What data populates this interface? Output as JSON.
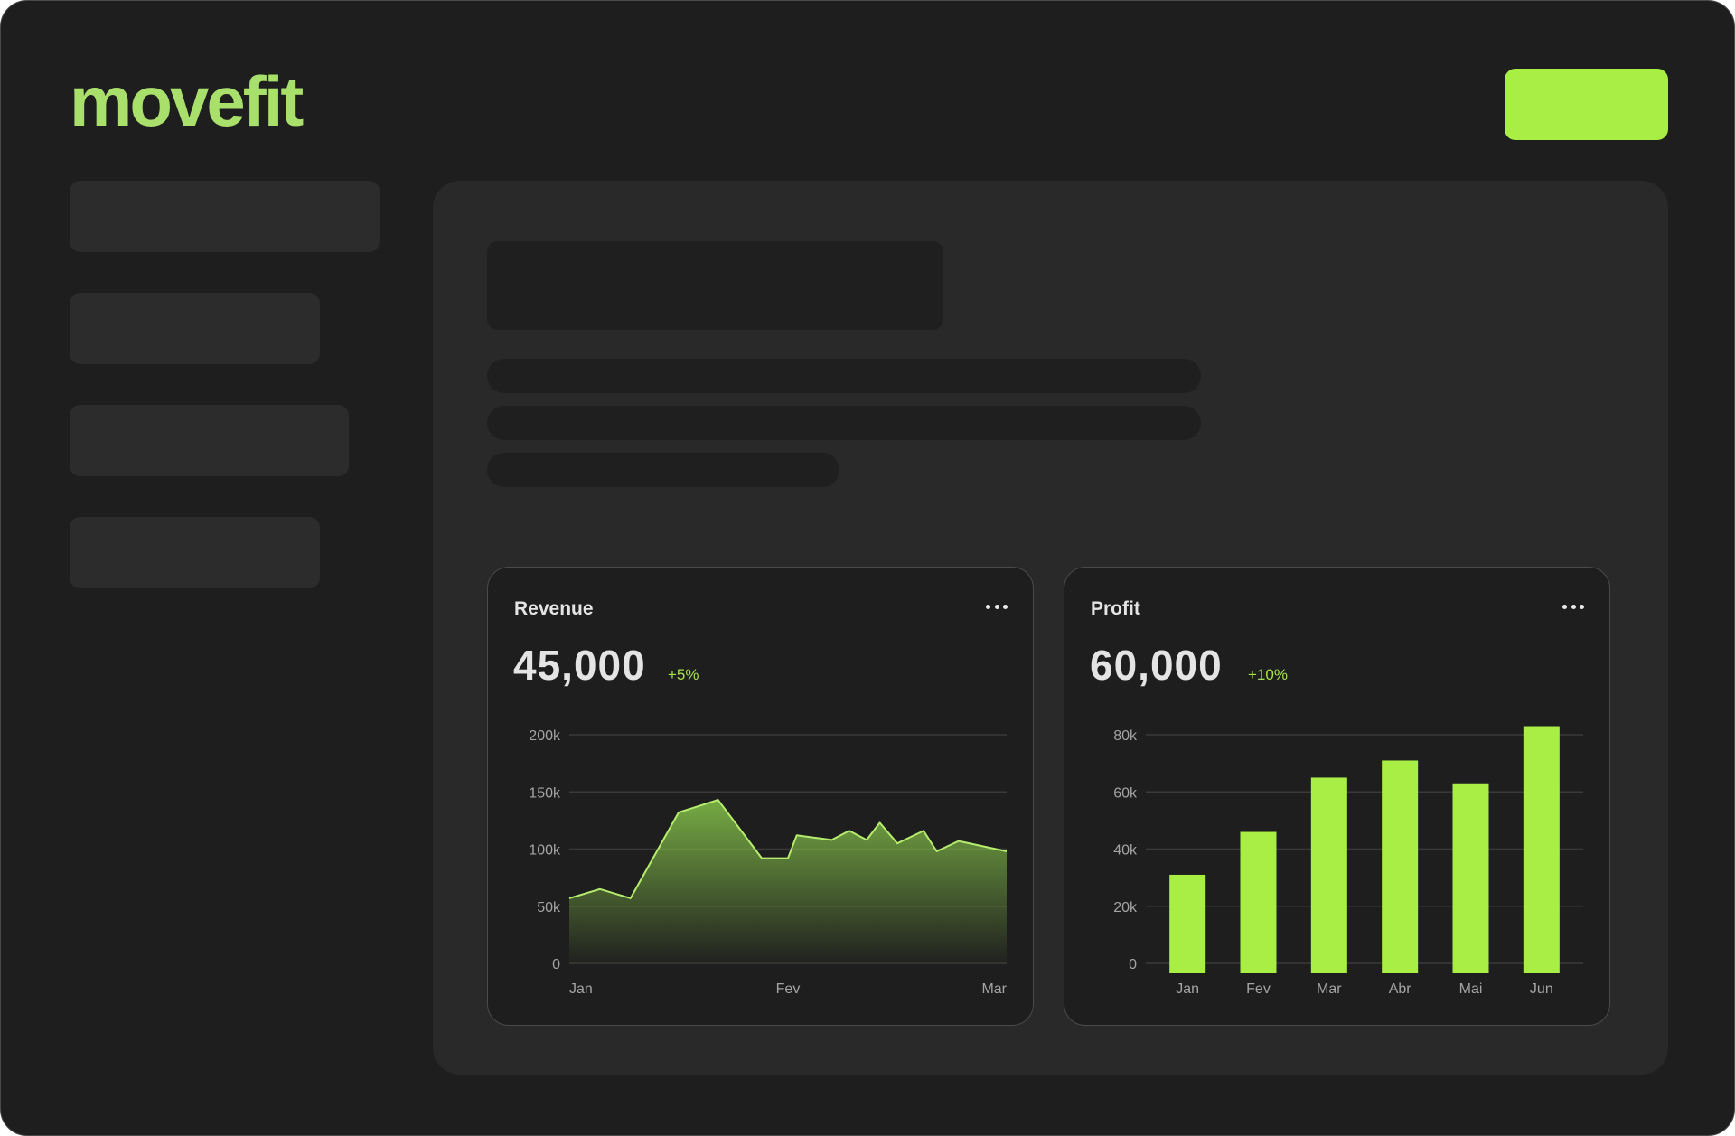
{
  "app": {
    "logo": "movefit"
  },
  "colors": {
    "accent": "#a8ee45",
    "background": "#1e1e1e",
    "panel": "#292929",
    "skeleton": "#2c2c2c"
  },
  "revenue_card": {
    "title": "Revenue",
    "value": "45,000",
    "delta": "+5%",
    "menu_icon": "more-horizontal-icon"
  },
  "profit_card": {
    "title": "Profit",
    "value": "60,000",
    "delta": "+10%",
    "menu_icon": "more-horizontal-icon"
  },
  "chart_data": [
    {
      "type": "area",
      "title": "Revenue",
      "x_ticks": [
        "Jan",
        "Fev",
        "Mar"
      ],
      "y_ticks": [
        "0",
        "50k",
        "100k",
        "150k",
        "200k"
      ],
      "ylim": [
        0,
        200000
      ],
      "xlim": [
        0,
        1
      ],
      "grid": true,
      "series": [
        {
          "values": [
            [
              0.0,
              57000
            ],
            [
              0.07,
              65000
            ],
            [
              0.14,
              57000
            ],
            [
              0.25,
              132000
            ],
            [
              0.34,
              143000
            ],
            [
              0.44,
              92000
            ],
            [
              0.5,
              92000
            ],
            [
              0.52,
              112000
            ],
            [
              0.6,
              108000
            ],
            [
              0.64,
              116000
            ],
            [
              0.68,
              108000
            ],
            [
              0.71,
              123000
            ],
            [
              0.75,
              105000
            ],
            [
              0.81,
              116000
            ],
            [
              0.84,
              98000
            ],
            [
              0.89,
              107000
            ],
            [
              1.0,
              98000
            ]
          ]
        }
      ]
    },
    {
      "type": "bar",
      "title": "Profit",
      "categories": [
        "Jan",
        "Fev",
        "Mar",
        "Abr",
        "Mai",
        "Jun"
      ],
      "values": [
        31000,
        46000,
        65000,
        71000,
        63000,
        83000
      ],
      "y_ticks": [
        "0",
        "20k",
        "40k",
        "60k",
        "80k"
      ],
      "ylim": [
        0,
        80000
      ],
      "grid": true
    }
  ]
}
